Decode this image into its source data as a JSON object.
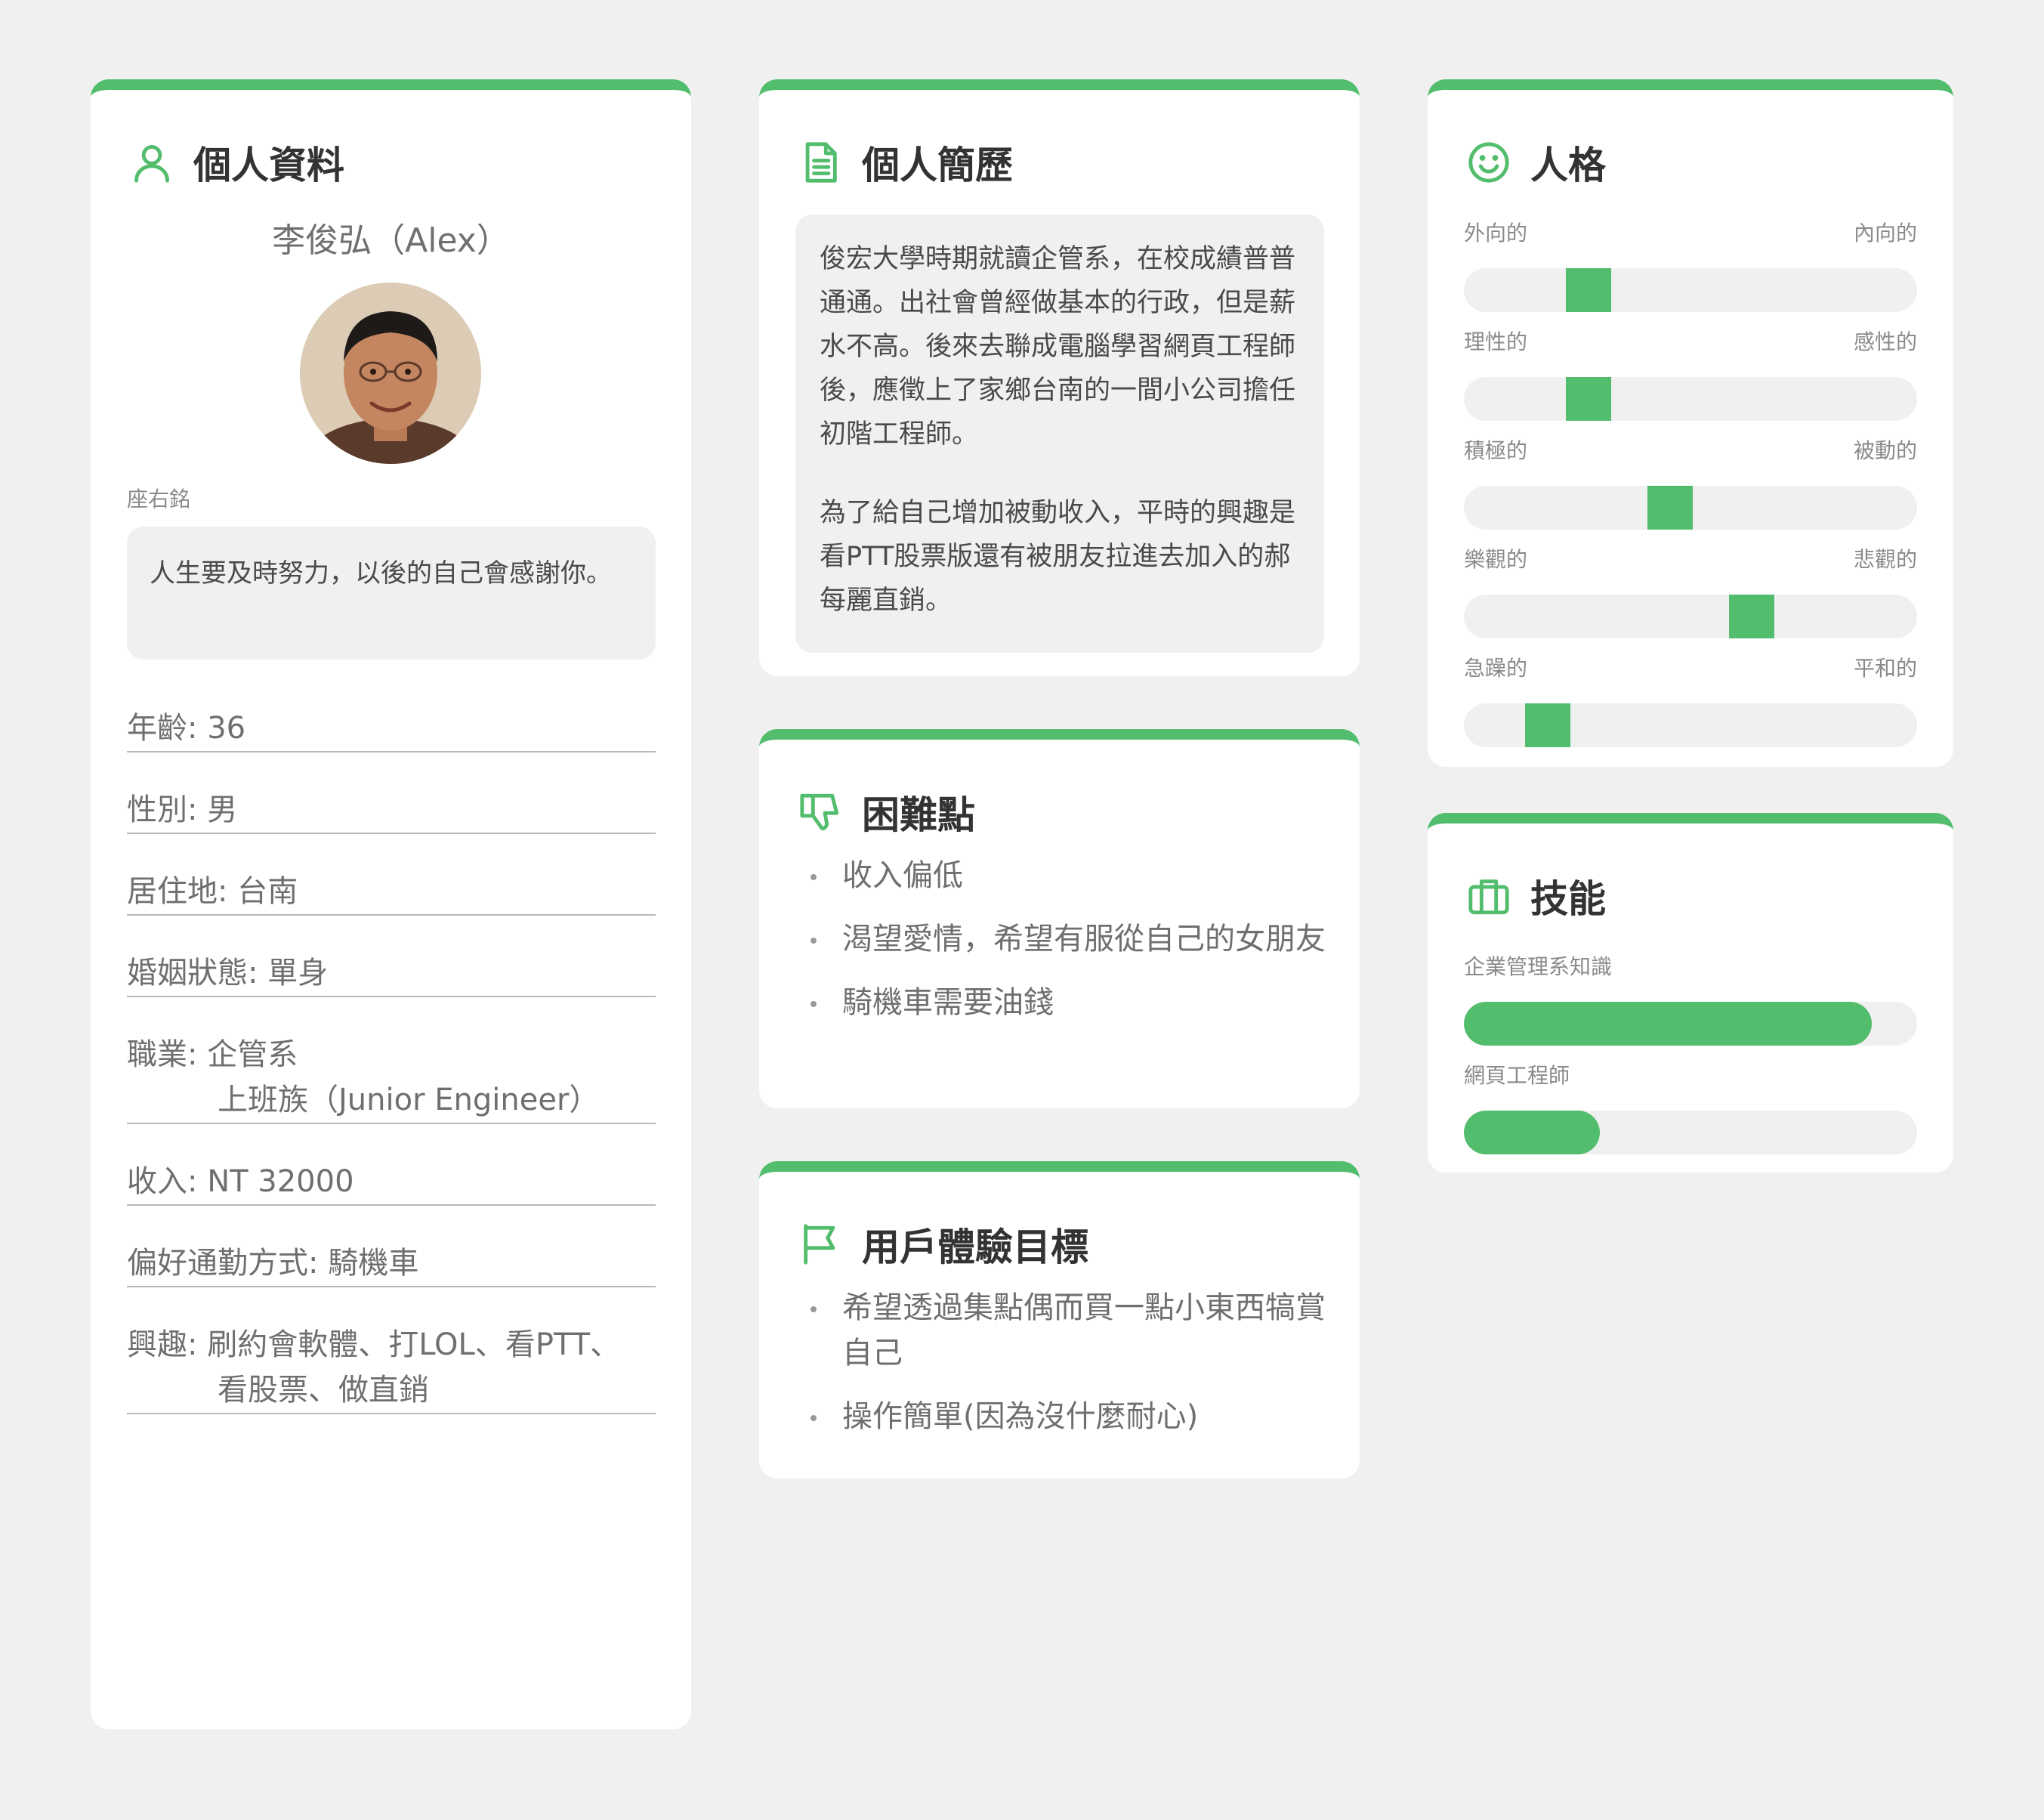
{
  "colors": {
    "accent": "#52bd6d",
    "background": "#f0f0f0",
    "panel": "#f0f0f0"
  },
  "profile": {
    "title": "個人資料",
    "icon": "user-icon",
    "name": "李俊弘（Alex）",
    "motto_label": "座右銘",
    "motto": "人生要及時努力，以後的自己會感謝你。",
    "fields": [
      {
        "label": "年齡:",
        "value": "36"
      },
      {
        "label": "性別:",
        "value": "男"
      },
      {
        "label": "居住地:",
        "value": "台南"
      },
      {
        "label": "婚姻狀態:",
        "value": "單身"
      },
      {
        "label": "職業:",
        "value": "企管系",
        "value2": "上班族（Junior Engineer）"
      },
      {
        "label": "收入:",
        "value": "NT 32000"
      },
      {
        "label": "偏好通勤方式:",
        "value": "騎機車"
      },
      {
        "label": "興趣:",
        "value": "刷約會軟體、打LOL、看PTT、",
        "value2": "看股票、做直銷"
      }
    ]
  },
  "resume": {
    "title": "個人簡歷",
    "icon": "document-icon",
    "paragraphs": [
      "俊宏大學時期就讀企管系，在校成績普普通通。出社會曾經做基本的行政，但是薪水不高。後來去聯成電腦學習網頁工程師後，應徵上了家鄉台南的一間小公司擔任初階工程師。",
      "為了給自己增加被動收入，平時的興趣是看PTT股票版還有被朋友拉進去加入的郝每麗直銷。"
    ]
  },
  "pain_points": {
    "title": "困難點",
    "icon": "thumbs-down-icon",
    "items": [
      "收入偏低",
      "渴望愛情，希望有服從自己的女朋友",
      "騎機車需要油錢"
    ]
  },
  "goals": {
    "title": "用戶體驗目標",
    "icon": "flag-icon",
    "items": [
      "希望透過集點偶而買一點小東西犒賞自己",
      "操作簡單(因為沒什麼耐心)"
    ]
  },
  "personality": {
    "title": "人格",
    "icon": "smiley-icon",
    "traits": [
      {
        "left": "外向的",
        "right": "內向的",
        "level": 0.25
      },
      {
        "left": "理性的",
        "right": "感性的",
        "level": 0.25
      },
      {
        "left": "積極的",
        "right": "被動的",
        "level": 0.45
      },
      {
        "left": "樂觀的",
        "right": "悲觀的",
        "level": 0.65
      },
      {
        "left": "急躁的",
        "right": "平和的",
        "level": 0.15
      }
    ]
  },
  "skills": {
    "title": "技能",
    "icon": "briefcase-icon",
    "items": [
      {
        "label": "企業管理系知識",
        "level": 0.9
      },
      {
        "label": "網頁工程師",
        "level": 0.3
      }
    ]
  }
}
